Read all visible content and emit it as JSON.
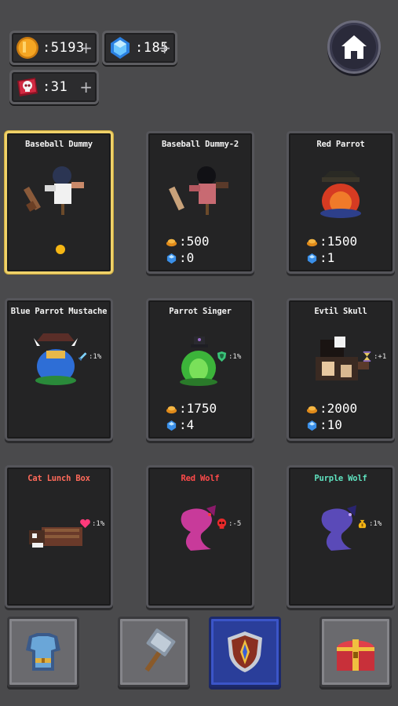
{
  "currencies": {
    "gold": {
      "value": ":5193",
      "plus": "+",
      "icon": "gold-coin-icon",
      "color": "#f5a623"
    },
    "gem": {
      "value": ":185",
      "plus": "+",
      "icon": "blue-gem-icon",
      "color": "#5ab8ff"
    },
    "ticket": {
      "value": ":31",
      "plus": "+",
      "icon": "skull-ticket-icon",
      "color": "#c8243a"
    }
  },
  "home": {
    "icon": "home-icon"
  },
  "cards": [
    {
      "title": "Baseball Dummy",
      "selected": true,
      "sprite": "baseball-dummy-sprite"
    },
    {
      "title": "Baseball Dummy-2",
      "gold": ":500",
      "gem": ":0",
      "sprite": "baseball-dummy-2-sprite"
    },
    {
      "title": "Red Parrot",
      "gold": ":1500",
      "gem": ":1",
      "sprite": "red-parrot-sprite"
    },
    {
      "title": "Blue Parrot Mustache",
      "buff": ":1%",
      "buff_icon": "sword-icon",
      "sprite": "blue-parrot-sprite"
    },
    {
      "title": "Parrot Singer",
      "gold": ":1750",
      "gem": ":4",
      "buff": ":1%",
      "buff_icon": "shield-icon",
      "sprite": "parrot-singer-sprite"
    },
    {
      "title": "Evtil Skull",
      "gold": ":2000",
      "gem": ":10",
      "buff": ":+1",
      "buff_icon": "hourglass-icon",
      "sprite": "evtil-skull-sprite"
    },
    {
      "title": "Cat Lunch Box",
      "title_color": "#ff6a5a",
      "buff": ":1%",
      "buff_icon": "heart-icon",
      "sprite": "cat-lunch-box-sprite"
    },
    {
      "title": "Red Wolf",
      "title_color": "#ff4a4a",
      "buff": ":-5",
      "buff_icon": "skull-icon",
      "sprite": "red-wolf-sprite"
    },
    {
      "title": "Purple Wolf",
      "title_color": "#5fe3c0",
      "buff": ":1%",
      "buff_icon": "money-bag-icon",
      "sprite": "purple-wolf-sprite"
    }
  ],
  "tabs": [
    {
      "name": "armor",
      "icon": "armor-icon",
      "active": false
    },
    {
      "name": "hammer",
      "icon": "hammer-icon",
      "active": false
    },
    {
      "name": "shield",
      "icon": "shield-emblem-icon",
      "active": true
    },
    {
      "name": "chest",
      "icon": "treasure-chest-icon",
      "active": false
    }
  ]
}
